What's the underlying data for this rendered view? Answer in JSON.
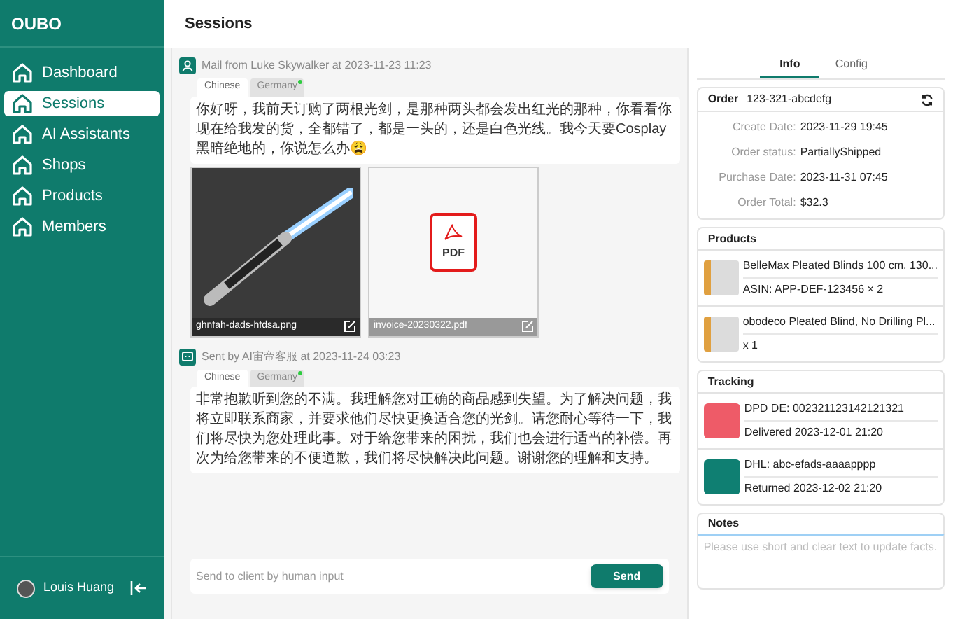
{
  "sidebar": {
    "brand": "OUBO",
    "items": [
      {
        "label": "Dashboard",
        "selected": false
      },
      {
        "label": "Sessions",
        "selected": true
      },
      {
        "label": "AI Assistants",
        "selected": false
      },
      {
        "label": "Shops",
        "selected": false
      },
      {
        "label": "Products",
        "selected": false
      },
      {
        "label": "Members",
        "selected": false
      }
    ],
    "user": {
      "name": "Louis Huang"
    }
  },
  "header": {
    "title": "Sessions"
  },
  "messages": [
    {
      "kind": "customer",
      "meta": "Mail from Luke Skywalker at 2023-11-23 11:23",
      "languages": [
        {
          "label": "Chinese",
          "selected": true,
          "translated": false
        },
        {
          "label": "Germany",
          "selected": false,
          "translated": true
        }
      ],
      "text": "你好呀，我前天订购了两根光剑，是那种两头都会发出红光的那种，你看看你现在给我发的货，全都错了，都是一头的，还是白色光线。我今天要Cosplay黑暗绝地的，你说怎么办😩",
      "attachments": [
        {
          "kind": "image",
          "name": "ghnfah-dads-hfdsa.png"
        },
        {
          "kind": "pdf",
          "name": "invoice-20230322.pdf",
          "icon_label": "PDF"
        }
      ]
    },
    {
      "kind": "ai",
      "meta": "Sent by AI宙帝客服 at 2023-11-24 03:23",
      "languages": [
        {
          "label": "Chinese",
          "selected": true,
          "translated": false
        },
        {
          "label": "Germany",
          "selected": false,
          "translated": true
        }
      ],
      "text": "非常抱歉听到您的不满。我理解您对正确的商品感到失望。为了解决问题，我将立即联系商家，并要求他们尽快更换适合您的光剑。请您耐心等待一下，我们将尽快为您处理此事。对于给您带来的困扰，我们也会进行适当的补偿。再次为给您带来的不便道歉，我们将尽快解决此问题。谢谢您的理解和支持。"
    }
  ],
  "composer": {
    "placeholder": "Send to client by human input",
    "send": "Send"
  },
  "panel": {
    "tabs": [
      {
        "label": "Info",
        "selected": true
      },
      {
        "label": "Config",
        "selected": false
      }
    ],
    "order": {
      "label": "Order",
      "id": "123-321-abcdefg",
      "fields": [
        {
          "label": "Create Date:",
          "value": "2023-11-29 19:45"
        },
        {
          "label": "Order status:",
          "value": "PartiallyShipped"
        },
        {
          "label": "Purchase Date:",
          "value": "2023-11-31 07:45"
        },
        {
          "label": "Order Total:",
          "value": "$32.3"
        }
      ]
    },
    "products": {
      "title": "Products",
      "items": [
        {
          "name": "BelleMax Pleated Blinds 100 cm, 130...",
          "detail": "ASIN: APP-DEF-123456 × 2"
        },
        {
          "name": "obodeco Pleated Blind, No Drilling Pl...",
          "detail": "x 1"
        }
      ]
    },
    "tracking": {
      "title": "Tracking",
      "items": [
        {
          "carrier": "DPD DE: 002321123142121321",
          "status": "Delivered 2023-12-01 21:20",
          "color": "#ee5b68"
        },
        {
          "carrier": "DHL: abc-efads-aaaapppp",
          "status": "Returned 2023-12-02 21:20",
          "color": "#0f7f72"
        }
      ]
    },
    "notes": {
      "title": "Notes",
      "placeholder": "Please use short and clear text to update facts."
    }
  }
}
